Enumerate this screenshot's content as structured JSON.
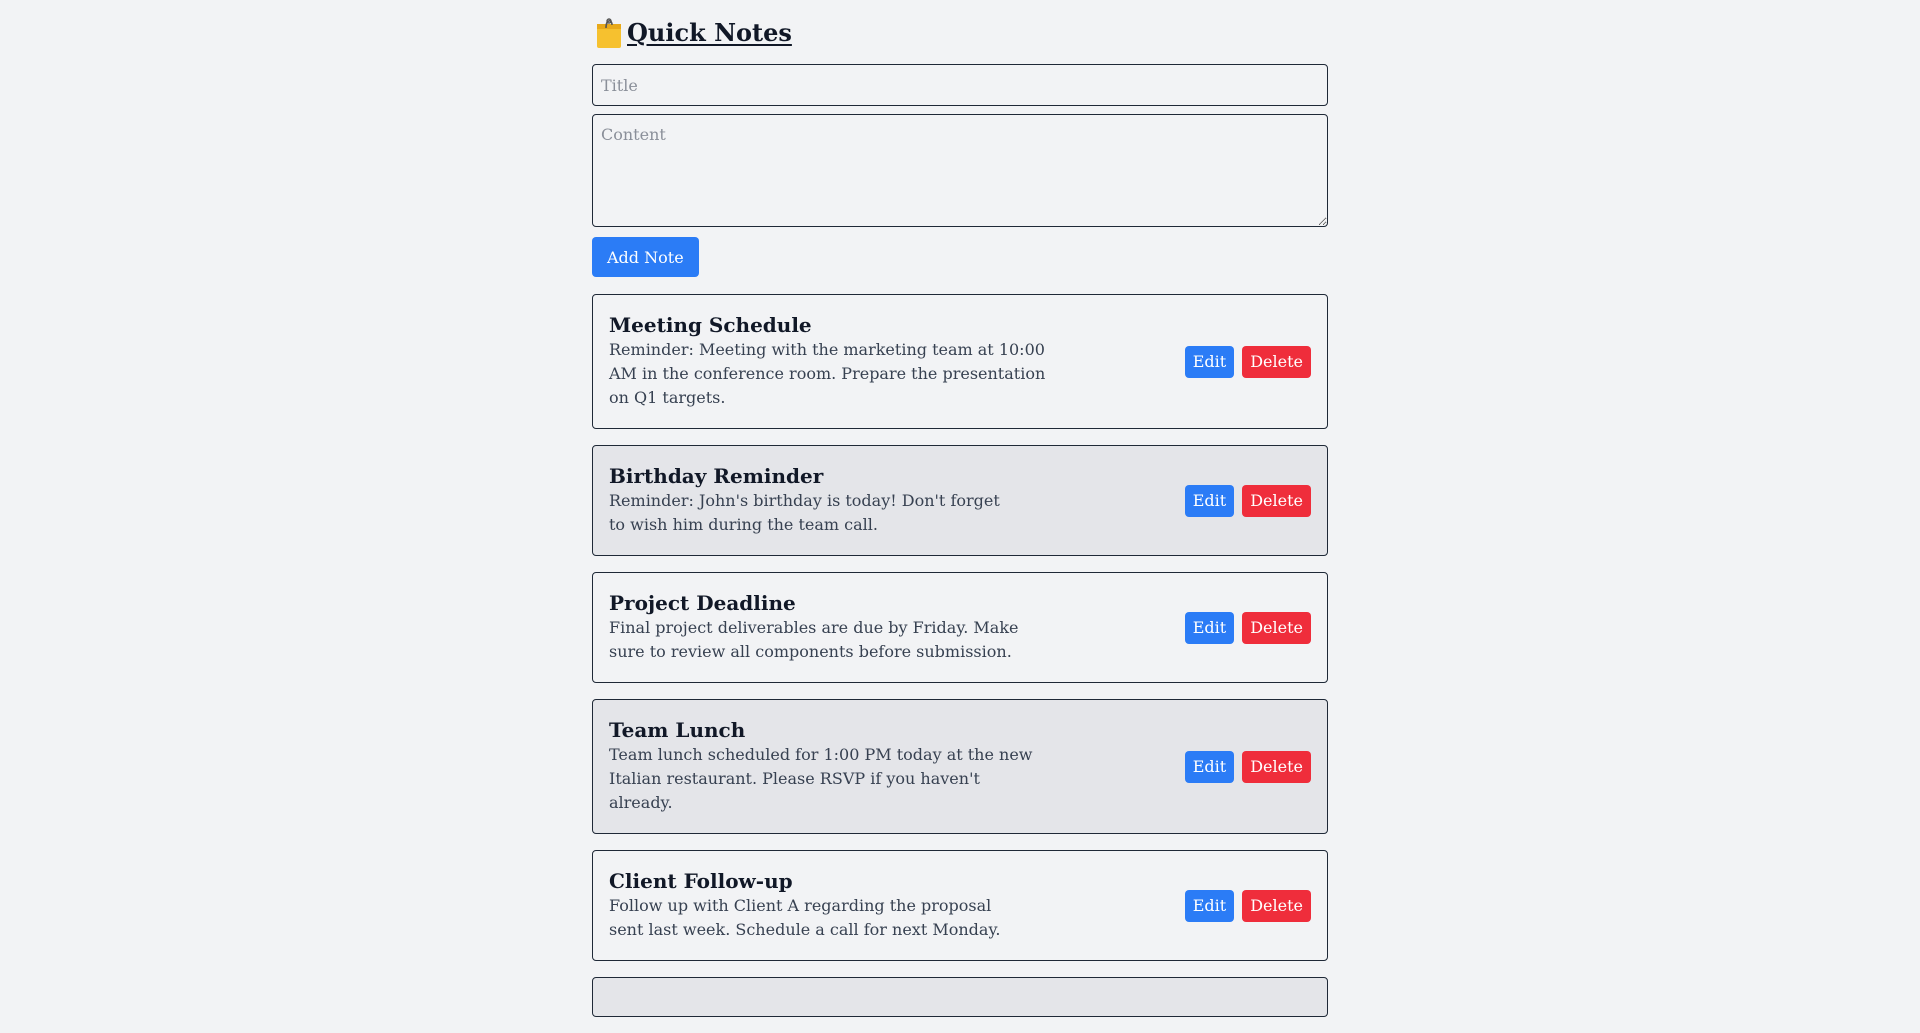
{
  "header": {
    "icon": "memo-icon",
    "title": "Quick Notes"
  },
  "form": {
    "title_placeholder": "Title",
    "title_value": "",
    "content_placeholder": "Content",
    "content_value": "",
    "add_label": "Add Note"
  },
  "colors": {
    "primary": "#2b7cf6",
    "danger": "#ef2d3b",
    "background": "#f2f3f5",
    "alt_card": "#e4e5e9"
  },
  "notes": [
    {
      "title": "Meeting Schedule",
      "content": "Reminder: Meeting with the marketing team at 10:00 AM in the conference room. Prepare the presentation on Q1 targets.",
      "edit_label": "Edit",
      "delete_label": "Delete"
    },
    {
      "title": "Birthday Reminder",
      "content": "Reminder: John's birthday is today! Don't forget to wish him during the team call.",
      "edit_label": "Edit",
      "delete_label": "Delete"
    },
    {
      "title": "Project Deadline",
      "content": "Final project deliverables are due by Friday. Make sure to review all components before submission.",
      "edit_label": "Edit",
      "delete_label": "Delete"
    },
    {
      "title": "Team Lunch",
      "content": "Team lunch scheduled for 1:00 PM today at the new Italian restaurant. Please RSVP if you haven't already.",
      "edit_label": "Edit",
      "delete_label": "Delete"
    },
    {
      "title": "Client Follow-up",
      "content": "Follow up with Client A regarding the proposal sent last week. Schedule a call for next Monday.",
      "edit_label": "Edit",
      "delete_label": "Delete"
    }
  ]
}
